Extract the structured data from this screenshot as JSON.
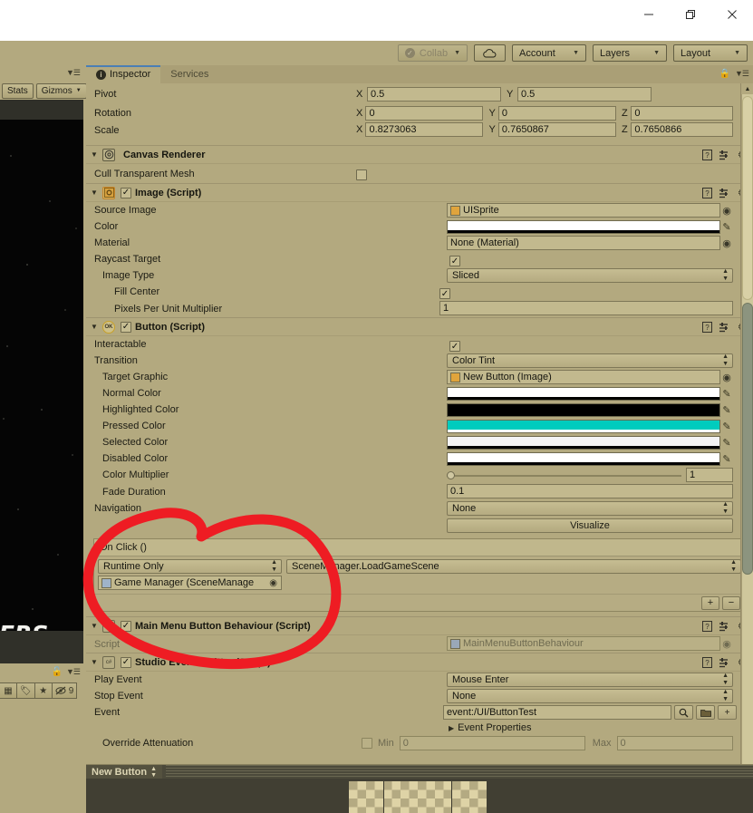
{
  "window": {
    "controls": [
      {
        "name": "minimize",
        "glyph": "minimize-icon"
      },
      {
        "name": "maximize",
        "glyph": "maximize-icon"
      },
      {
        "name": "close",
        "glyph": "close-icon"
      }
    ]
  },
  "toolbar": {
    "collab_label": "Collab",
    "cloud_label": "cloud-icon",
    "account_label": "Account",
    "layers_label": "Layers",
    "layout_label": "Layout"
  },
  "game_panel": {
    "stats_label": "Stats",
    "gizmos_label": "Gizmos",
    "game_title_text": "MERS",
    "hidden_count": "9",
    "icons": [
      "prefab-icon",
      "tag-icon",
      "star-icon",
      "eye-off-icon"
    ]
  },
  "inspector": {
    "tabs": [
      {
        "label": "Inspector",
        "active": true,
        "icon": "info-icon"
      },
      {
        "label": "Services",
        "active": false,
        "icon": ""
      }
    ],
    "lock_icon": "lock-icon",
    "options_icon": "options-menu-icon"
  },
  "transform": {
    "pivot": {
      "label": "Pivot",
      "x_axis": "X",
      "x": "0.5",
      "y_axis": "Y",
      "y": "0.5"
    },
    "rotation": {
      "label": "Rotation",
      "x_axis": "X",
      "x": "0",
      "y_axis": "Y",
      "y": "0",
      "z_axis": "Z",
      "z": "0"
    },
    "scale": {
      "label": "Scale",
      "x_axis": "X",
      "x": "0.8273063",
      "y_axis": "Y",
      "y": "0.7650867",
      "z_axis": "Z",
      "z": "0.7650866"
    }
  },
  "canvas_renderer": {
    "title": "Canvas Renderer",
    "icon": "canvas-renderer-icon",
    "cull_transparent_mesh": {
      "label": "Cull Transparent Mesh",
      "checked": false
    }
  },
  "image_script": {
    "title": "Image (Script)",
    "icon": "image-component-icon",
    "enabled": true,
    "source_image": {
      "label": "Source Image",
      "value": "UISprite"
    },
    "color": {
      "label": "Color",
      "value": "#FFFFFF",
      "alpha": "#000000"
    },
    "material": {
      "label": "Material",
      "value": "None (Material)"
    },
    "raycast_target": {
      "label": "Raycast Target",
      "checked": true
    },
    "image_type": {
      "label": "Image Type",
      "value": "Sliced"
    },
    "fill_center": {
      "label": "Fill Center",
      "checked": true
    },
    "pixels_per_unit_multiplier": {
      "label": "Pixels Per Unit Multiplier",
      "value": "1"
    }
  },
  "button_script": {
    "title": "Button (Script)",
    "icon": "button-component-icon",
    "enabled": true,
    "interactable": {
      "label": "Interactable",
      "checked": true
    },
    "transition": {
      "label": "Transition",
      "value": "Color Tint"
    },
    "target_graphic": {
      "label": "Target Graphic",
      "value": "New Button (Image)"
    },
    "normal_color": {
      "label": "Normal Color",
      "value": "#FFFFFF",
      "alpha": "#000000"
    },
    "highlighted_color": {
      "label": "Highlighted Color",
      "value": "#000000",
      "alpha": "#000000"
    },
    "pressed_color": {
      "label": "Pressed Color",
      "value": "#00CCBE",
      "alpha": "#FFFFFF"
    },
    "selected_color": {
      "label": "Selected Color",
      "value": "#F4F4F4",
      "alpha": "#000000"
    },
    "disabled_color": {
      "label": "Disabled Color",
      "value": "#FFFFFF",
      "alpha": "#000000"
    },
    "color_multiplier": {
      "label": "Color Multiplier",
      "value": "1"
    },
    "fade_duration": {
      "label": "Fade Duration",
      "value": "0.1"
    },
    "navigation": {
      "label": "Navigation",
      "value": "None"
    },
    "visualize_label": "Visualize"
  },
  "on_click": {
    "header": "On Click ()",
    "entry": {
      "mode": "Runtime Only",
      "method": "SceneManager.LoadGameScene",
      "object": "Game Manager (SceneManage"
    },
    "add_label": "+",
    "remove_label": "−"
  },
  "main_menu_behaviour": {
    "title": "Main Menu Button Behaviour (Script)",
    "enabled": true,
    "script": {
      "label": "Script",
      "value": "MainMenuButtonBehaviour"
    }
  },
  "studio_event_emitter": {
    "title": "Studio Event Emitter (Script)",
    "icon": "csharp-script-icon",
    "enabled": true,
    "play_event": {
      "label": "Play Event",
      "value": "Mouse Enter"
    },
    "stop_event": {
      "label": "Stop Event",
      "value": "None"
    },
    "event": {
      "label": "Event",
      "value": "event:/UI/ButtonTest"
    },
    "event_buttons": [
      "search-icon",
      "folder-icon",
      "plus-icon"
    ],
    "event_properties": {
      "label": "Event Properties"
    },
    "override_attenuation": {
      "label": "Override Attenuation",
      "checked": false,
      "min_label": "Min",
      "min_value": "0",
      "max_label": "Max",
      "max_value": "0"
    }
  },
  "preview": {
    "tab_label": "New Button"
  },
  "annotation": {
    "color": "#EE1C23",
    "shape": "hand-drawn-circle",
    "targets": "On Click () section"
  },
  "theme": {
    "background": "#b3a97f",
    "field_bg": "#c2b98e",
    "border": "#7e7757",
    "text": "#1b1b13",
    "accent_tab": "#4a7fb5"
  }
}
